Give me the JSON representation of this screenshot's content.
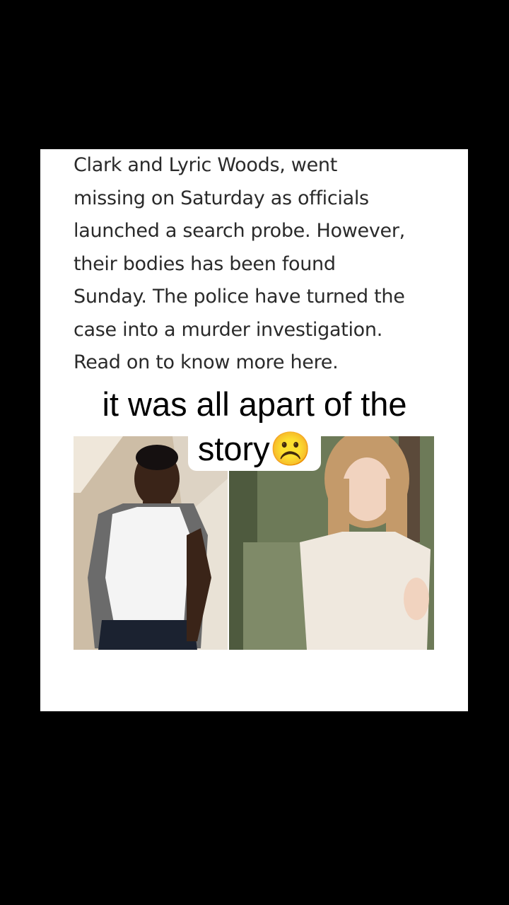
{
  "article": {
    "lines": [
      "Clark and Lyric Woods, went",
      "missing on Saturday as officials",
      "launched a search probe. However,",
      "their bodies has been found",
      "Sunday. The police have turned the",
      "case into a murder investigation.",
      "Read on to know more here."
    ]
  },
  "caption": {
    "line1": "it was all apart of the",
    "line2": "story☹️"
  },
  "ad": {
    "play_icon": "▷",
    "close_icon": "✕"
  },
  "colors": {
    "background": "#000000",
    "card": "#ffffff",
    "ad_accent": "#3ea1f0"
  }
}
